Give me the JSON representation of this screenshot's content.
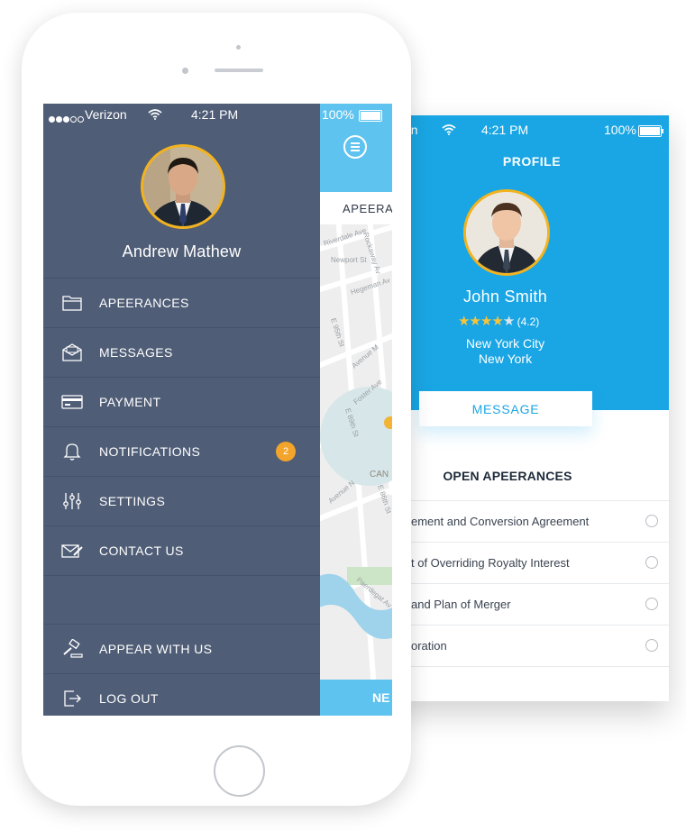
{
  "profile_screen": {
    "status": {
      "carrier_partial": "on",
      "time": "4:21 PM",
      "battery": "100%"
    },
    "title": "PROFILE",
    "name": "John Smith",
    "rating": {
      "stars_filled": 4,
      "stars_total": 5,
      "text": "(4.2)"
    },
    "location_line1": "New York City",
    "location_line2": "New York",
    "message_button": "MESSAGE",
    "open_appearances_title": "OPEN APEERANCES",
    "appearances": [
      {
        "label": "ement and Conversion Agreement"
      },
      {
        "label": "t of Overriding Royalty Interest"
      },
      {
        "label": "and Plan of Merger"
      },
      {
        "label": "oration"
      }
    ]
  },
  "drawer_screen": {
    "status": {
      "carrier": "Verizon",
      "time": "4:21 PM",
      "battery": "100%"
    },
    "user_name": "Andrew Mathew",
    "menu": [
      {
        "label": "APEERANCES",
        "icon": "folder-icon"
      },
      {
        "label": "MESSAGES",
        "icon": "mail-icon"
      },
      {
        "label": "PAYMENT",
        "icon": "credit-card-icon"
      },
      {
        "label": "NOTIFICATIONS",
        "icon": "bell-icon",
        "badge": "2"
      },
      {
        "label": "SETTINGS",
        "icon": "sliders-icon"
      },
      {
        "label": "CONTACT US",
        "icon": "envelope-pen-icon"
      }
    ],
    "bottom_menu": [
      {
        "label": "APPEAR WITH US",
        "icon": "gavel-icon"
      },
      {
        "label": "LOG OUT",
        "icon": "logout-icon"
      }
    ],
    "map_peek": {
      "tab_label": "APEERA",
      "bottom_label": "NE",
      "street_labels": [
        "Riverdale Ave",
        "Newport St",
        "Rockaway Av",
        "Hegeman Av",
        "E 95th St",
        "Avenue M",
        "Foster Ave",
        "E 89th St",
        "CAN",
        "Avenue N",
        "E 86th St",
        "Paerdegat Av"
      ]
    },
    "colors": {
      "drawer_bg": "#4f5d76",
      "accent_blue": "#1aa6e4",
      "map_blue": "#5fc3ef",
      "badge": "#f3a42a",
      "avatar_ring": "#f2b31e"
    }
  }
}
